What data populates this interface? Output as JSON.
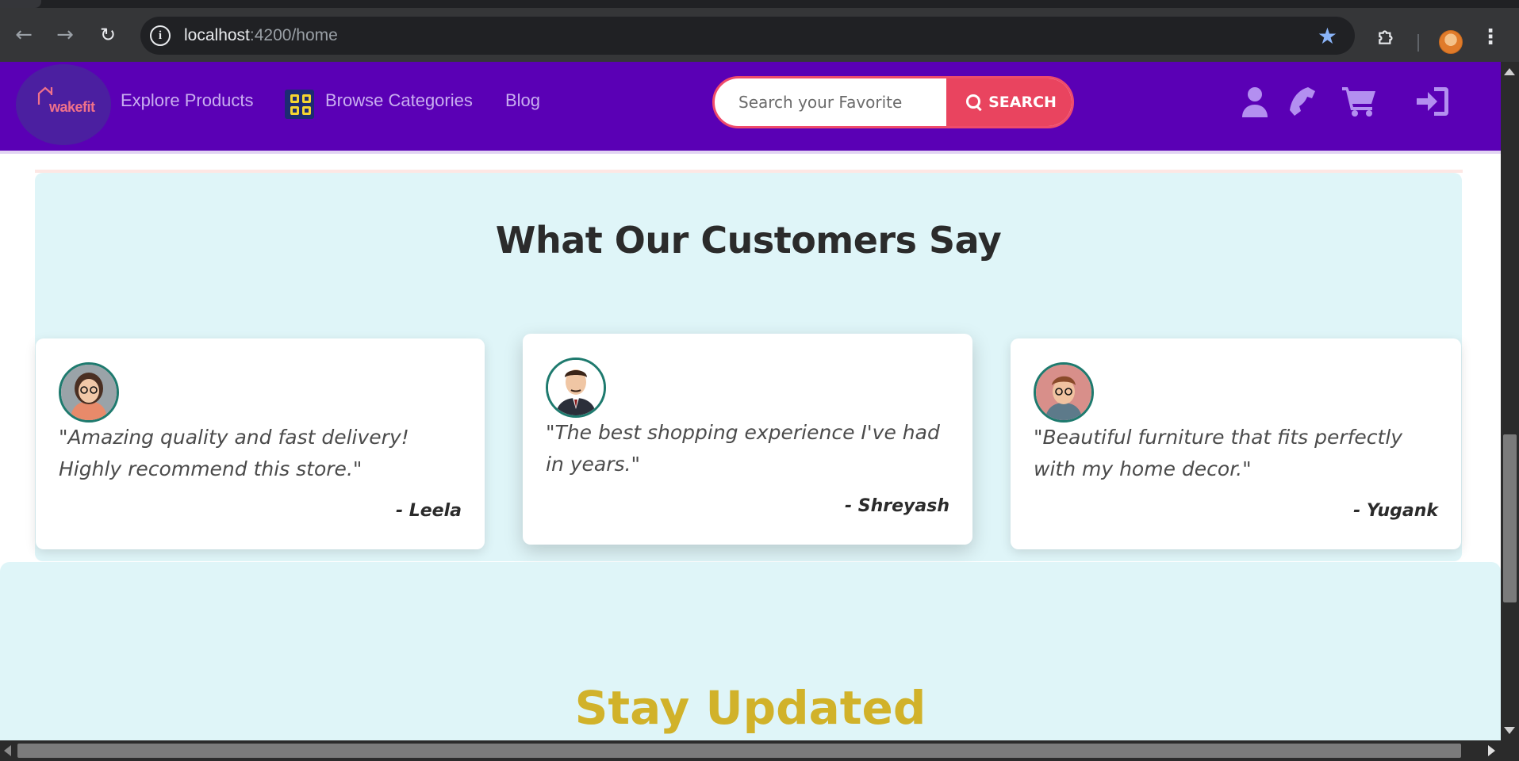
{
  "browser": {
    "url_host": "localhost",
    "url_port_path": ":4200/home",
    "icons": {
      "back": "arrow-left-icon",
      "forward": "arrow-right-icon",
      "reload": "reload-icon",
      "site_info": "info-icon",
      "bookmark": "star-icon",
      "extensions": "puzzle-icon",
      "profile": "avatar",
      "menu": "kebab-menu-icon"
    }
  },
  "navbar": {
    "background": "#5a00b5",
    "logo_text": "wakefit",
    "links": {
      "explore": "Explore Products",
      "categories": "Browse Categories",
      "blog": "Blog"
    },
    "search": {
      "placeholder": "Search your Favorite",
      "button_label": "SEARCH",
      "accent": "#e9445f"
    },
    "icons": [
      "user-icon",
      "phone-icon",
      "cart-icon",
      "sign-in-icon"
    ]
  },
  "testimonials": {
    "title": "What Our Customers Say",
    "background": "#dff5f8",
    "items": [
      {
        "quote": "\"Amazing quality and fast delivery! Highly recommend this store.\"",
        "author": "- Leela"
      },
      {
        "quote": "\"The best shopping experience I've had in years.\"",
        "author": "- Shreyash"
      },
      {
        "quote": "\"Beautiful furniture that fits perfectly with my home decor.\"",
        "author": "- Yugank"
      }
    ]
  },
  "newsletter": {
    "title": "Stay Updated",
    "title_color": "#d1b22a"
  }
}
